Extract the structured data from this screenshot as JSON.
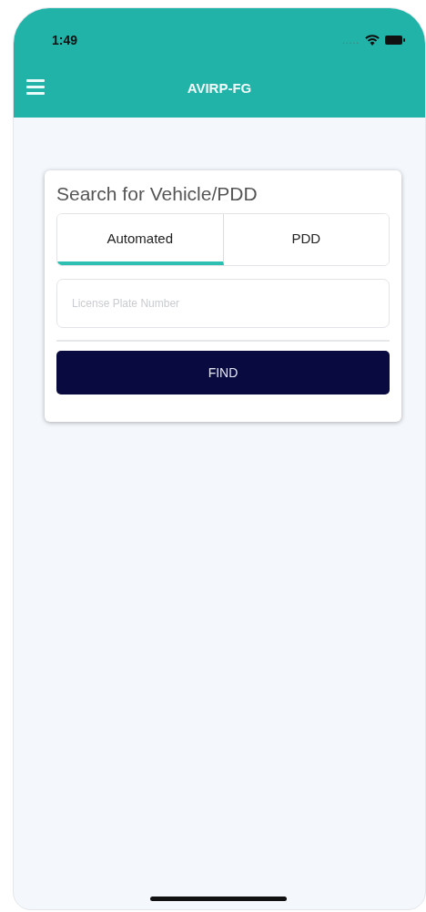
{
  "status_bar": {
    "time": "1:49",
    "signal_dots": "....."
  },
  "header": {
    "title": "AVIRP-FG"
  },
  "search_card": {
    "title": "Search for Vehicle/PDD",
    "tabs": [
      {
        "label": "Automated",
        "selected": true
      },
      {
        "label": "PDD",
        "selected": false
      }
    ],
    "plate_field": {
      "placeholder": "License Plate Number"
    },
    "find_button": {
      "label": "FIND"
    }
  }
}
